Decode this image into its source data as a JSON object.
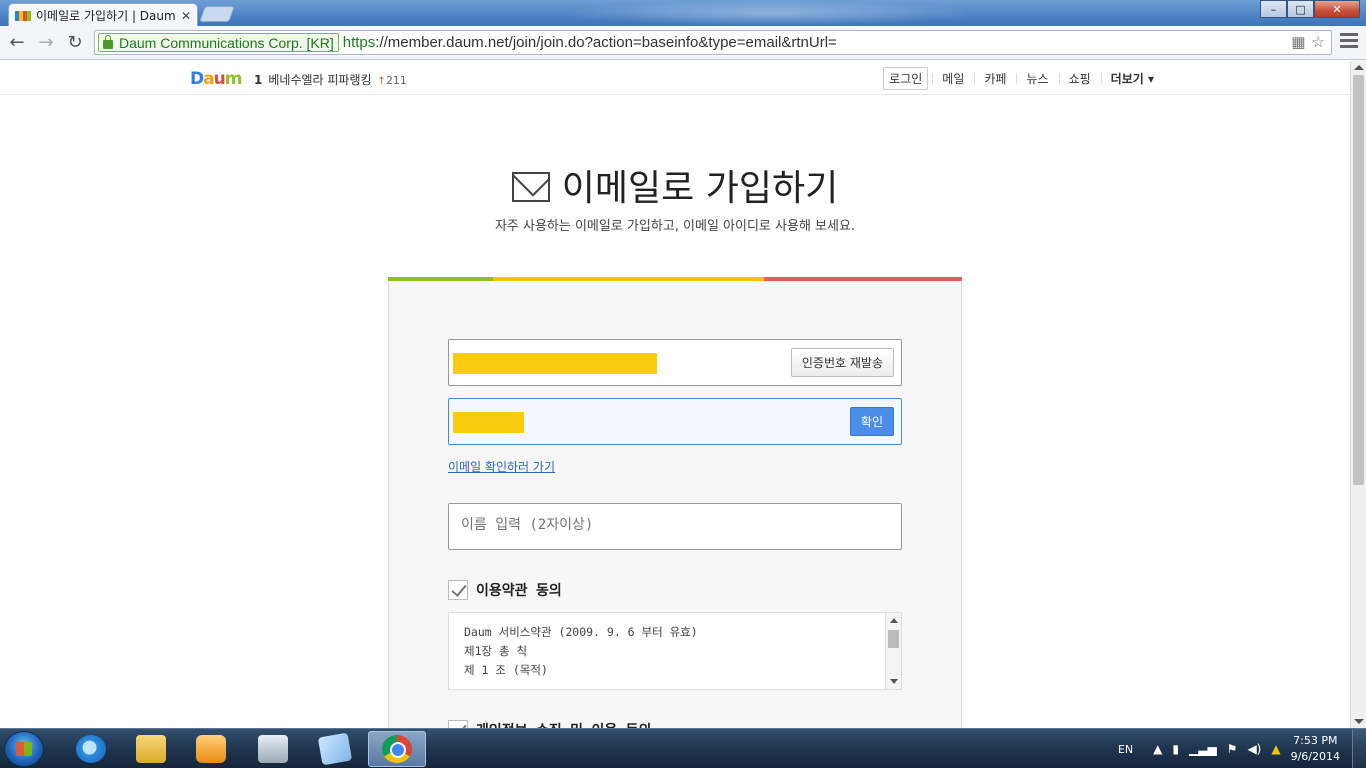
{
  "browser": {
    "tab_title": "이메일로 가입하기 | Daum",
    "tab_close": "✕",
    "ev_label": "Daum Communications Corp. [KR]",
    "url_scheme": "https",
    "url_rest": "://member.daum.net/join/join.do?action=baseinfo&type=email&rtnUrl=",
    "window_controls": {
      "minimize": "–",
      "maximize": "□",
      "close": "✕"
    },
    "nav": {
      "back": "←",
      "forward": "→",
      "reload": "↻"
    }
  },
  "gnb": {
    "logo": "Daum",
    "rank_num": "1",
    "rank_text": "베네수엘라 피파랭킹",
    "rank_arrow": "↑",
    "rank_count": "211",
    "login": "로그인",
    "menu": [
      "메일",
      "카페",
      "뉴스",
      "쇼핑"
    ],
    "more": "더보기 ▾"
  },
  "hero": {
    "title": "이메일로 가입하기",
    "subtitle": "자주 사용하는 이메일로 가입하고, 이메일 아이디로 사용해 보세요."
  },
  "form": {
    "resend_button": "인증번호 재발송",
    "confirm_button": "확인",
    "check_email_link": "이메일 확인하러 가기",
    "name_placeholder": "이름 입력 (2자이상)",
    "terms_agree_label": "이용약관 동의",
    "terms_lines": [
      "Daum 서비스약관 (2009. 9. 6 부터 유효)",
      "제1장 총 칙",
      "제 1 조 (목적)"
    ],
    "privacy_agree_label": "개인정보 수집 및 이용 동의"
  },
  "taskbar": {
    "lang": "EN",
    "time": "7:53 PM",
    "date": "9/6/2014"
  },
  "colors": {
    "bar_green": "#8ec31f",
    "bar_yellow": "#f5c500",
    "bar_red": "#e85c5c",
    "redaction": "#fccc11",
    "confirm_blue": "#4a8eea"
  }
}
